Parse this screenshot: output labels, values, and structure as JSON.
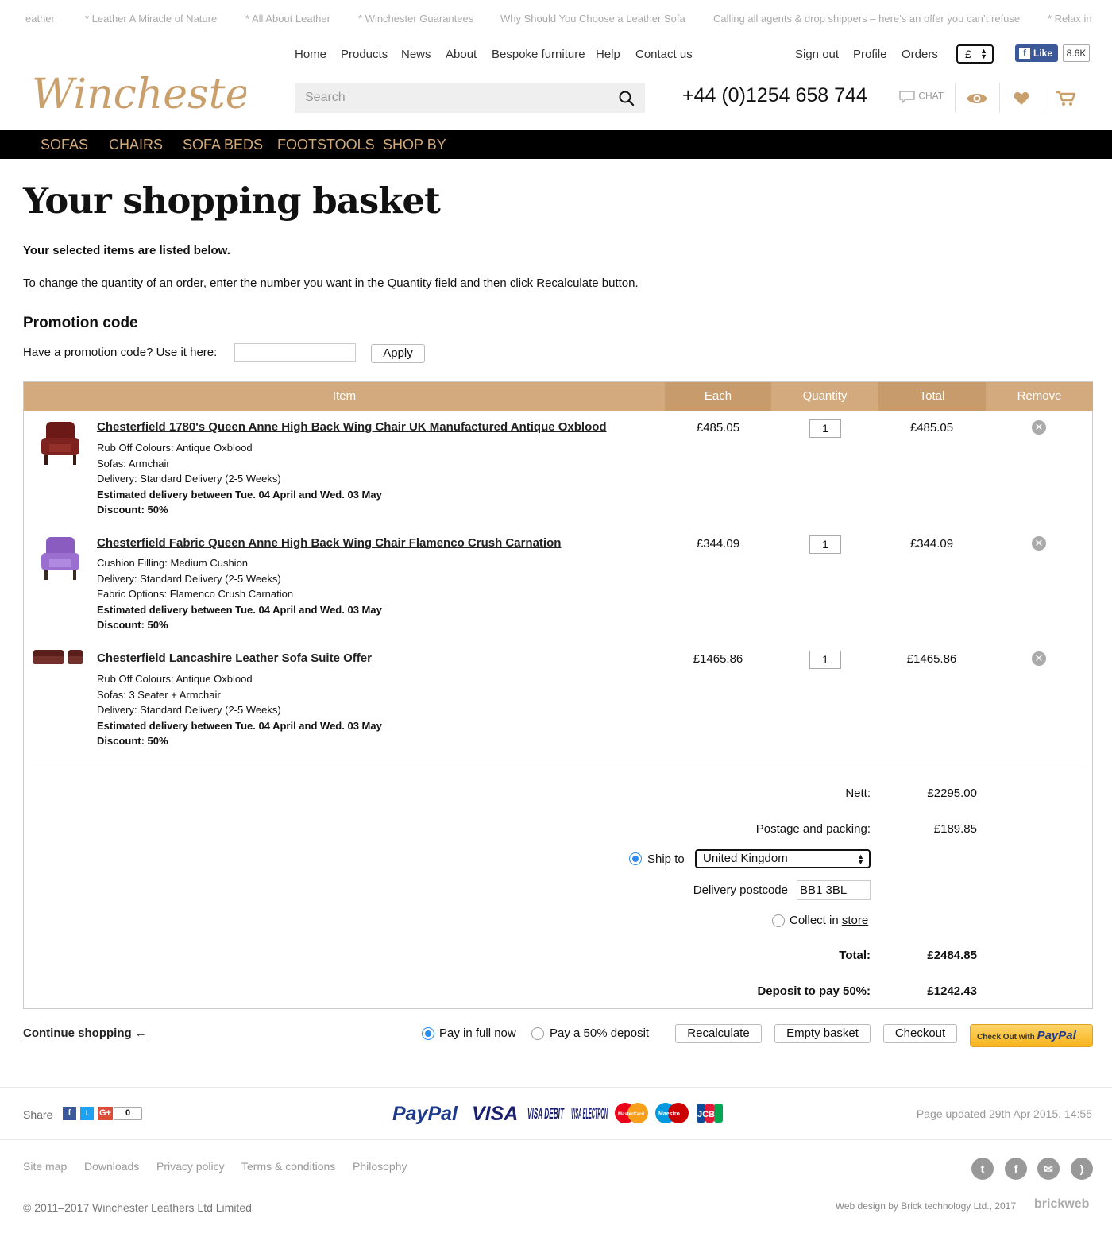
{
  "ticker": [
    "eather",
    "* Leather A Miracle of Nature",
    "* All About Leather",
    "* Winchester Guarantees",
    "Why Should You Choose a Leather Sofa",
    "Calling all agents & drop shippers – here’s an offer you can’t refuse",
    "* Relax in"
  ],
  "logo_text": "Winchester",
  "topnav": [
    "Home",
    "Products",
    "News",
    "About",
    "Bespoke furniture",
    "Help",
    "Contact us"
  ],
  "account": [
    "Sign out",
    "Profile",
    "Orders"
  ],
  "currency": "£",
  "facebook": {
    "like": "Like",
    "count": "8.6K"
  },
  "search_placeholder": "Search",
  "phone": "+44 (0)1254 658 744",
  "chat": "CHAT",
  "categories": [
    "Sofas",
    "Chairs",
    "Sofa beds",
    "Footstools",
    "Shop by"
  ],
  "page_title": "Your shopping basket",
  "selected_text": "Your selected items are listed below.",
  "intro_text": "To change the quantity of an order, enter the number you want in the Quantity field and then click Recalculate button.",
  "promo": {
    "heading": "Promotion code",
    "label": "Have a promotion code? Use it here:",
    "apply": "Apply"
  },
  "table_headers": [
    "Item",
    "Each",
    "Quantity",
    "Total",
    "Remove"
  ],
  "colors": {
    "gold": "#d3a97a",
    "header_light": "#d3aa7d",
    "header_dark": "#c79b6b",
    "blue": "#2d8cf0"
  },
  "items": [
    {
      "name": "Chesterfield 1780's Queen Anne High Back Wing Chair UK Manufactured Antique Oxblood",
      "options": [
        "Rub Off Colours: Antique Oxblood",
        "Sofas: Armchair",
        "Delivery: Standard Delivery (2-5 Weeks)"
      ],
      "estimate": "Estimated delivery between Tue. 04 April and Wed. 03 May",
      "discount": "Discount: 50%",
      "each": "£485.05",
      "qty": "1",
      "total": "£485.05"
    },
    {
      "name": "Chesterfield Fabric Queen Anne High Back Wing Chair Flamenco Crush Carnation",
      "options": [
        "Cushion Filling: Medium Cushion",
        "Delivery: Standard Delivery (2-5 Weeks)",
        "Fabric Options: Flamenco Crush Carnation"
      ],
      "estimate": "Estimated delivery between Tue. 04 April and Wed. 03 May",
      "discount": "Discount: 50%",
      "each": "£344.09",
      "qty": "1",
      "total": "£344.09"
    },
    {
      "name": "Chesterfield Lancashire Leather Sofa Suite Offer",
      "options": [
        "Rub Off Colours: Antique Oxblood",
        "Sofas: 3 Seater + Armchair",
        "Delivery: Standard Delivery (2-5 Weeks)"
      ],
      "estimate": "Estimated delivery between Tue. 04 April and Wed. 03 May",
      "discount": "Discount: 50%",
      "each": "£1465.86",
      "qty": "1",
      "total": "£1465.86"
    }
  ],
  "summary": {
    "nett_label": "Nett:",
    "nett": "£2295.00",
    "postage_label": "Postage and packing:",
    "postage": "£189.85",
    "ship_to": "Ship to",
    "country": "United Kingdom",
    "postcode_label": "Delivery postcode",
    "postcode": "BB1 3BL",
    "collect_label": "Collect in",
    "collect_link": "store",
    "total_label": "Total:",
    "total": "£2484.85",
    "deposit_label": "Deposit to pay 50%:",
    "deposit": "£1242.43"
  },
  "actions": {
    "continue": "Continue shopping ←",
    "pay_full": "Pay in full now",
    "pay_deposit": "Pay a 50% deposit",
    "recalculate": "Recalculate",
    "empty": "Empty basket",
    "checkout": "Checkout",
    "paypal_small": "Check Out with",
    "paypal_brand": "PayPal"
  },
  "footer": {
    "share": "Share",
    "share_count": "0",
    "payment_logos": [
      "PayPal",
      "VISA",
      "VISA DEBIT",
      "VISA ELECTRON",
      "MasterCard",
      "Maestro",
      "JCB"
    ],
    "updated": "Page updated 29th Apr 2015, 14:55",
    "links": [
      "Site map",
      "Downloads",
      "Privacy policy",
      "Terms & conditions",
      "Philosophy"
    ],
    "copyright": "© 2011–2017  Winchester Leathers Ltd Limited",
    "credit": "Web design by Brick technology Ltd., 2017",
    "credit_logo": "brickweb"
  }
}
